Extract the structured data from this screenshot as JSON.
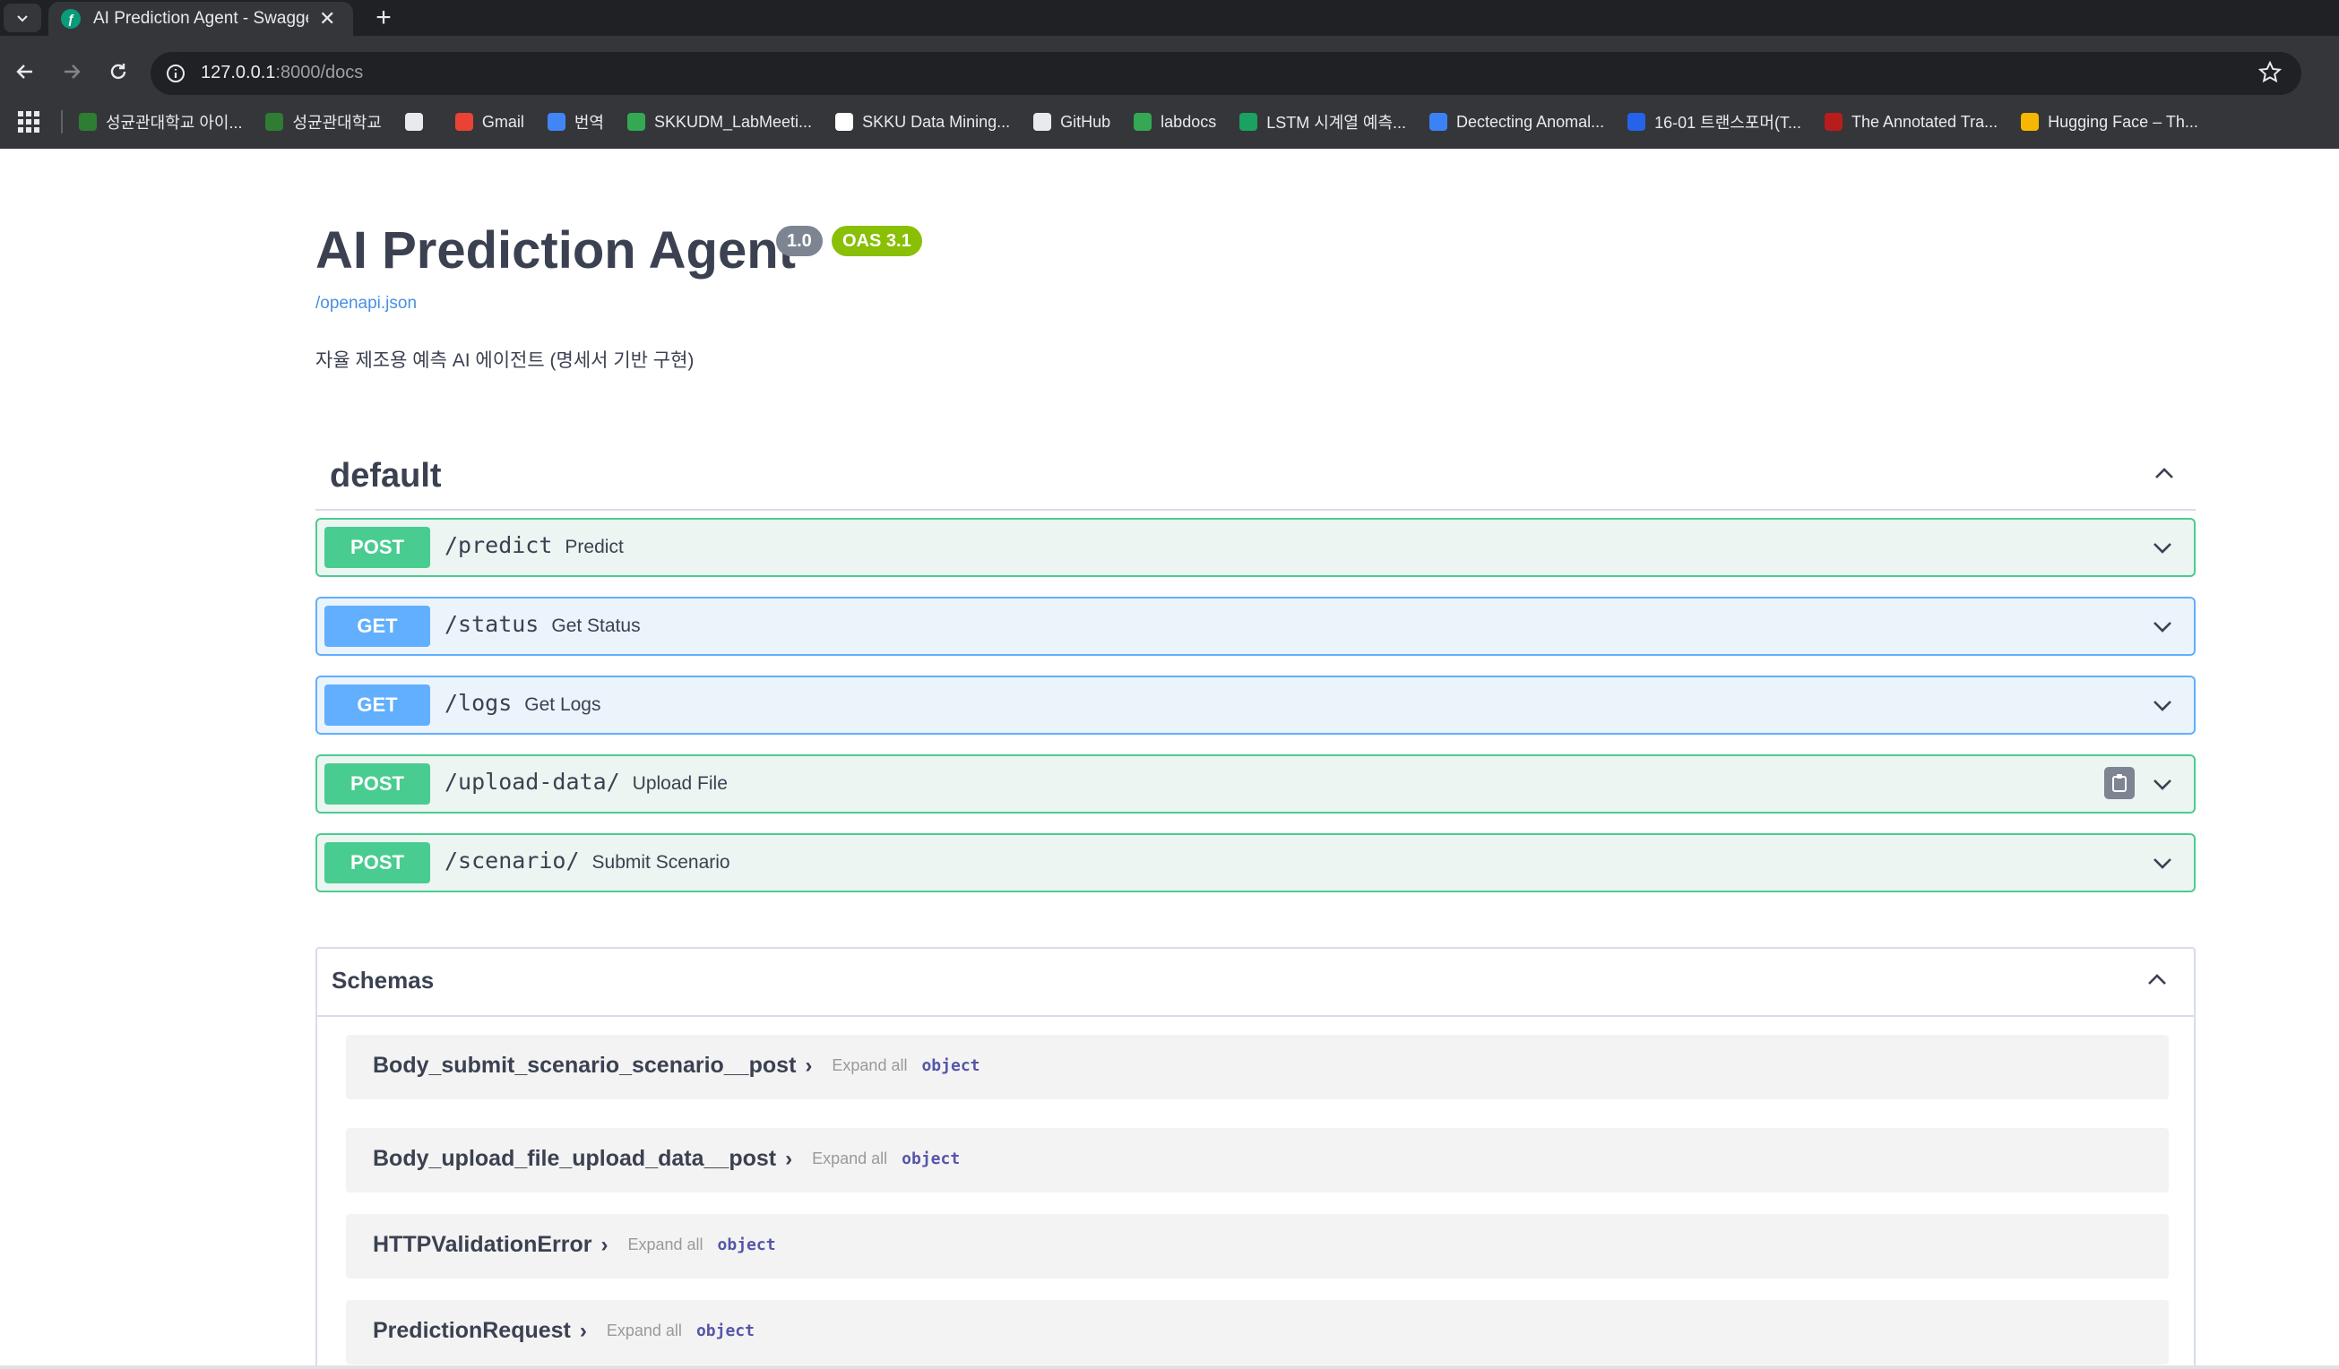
{
  "browser": {
    "tab_title": "AI Prediction Agent - Swagger UI",
    "url_host": "127.0.0.1",
    "url_rest": ":8000/docs",
    "bookmarks": [
      {
        "label": "성균관대학교 아이...",
        "color": "#2e7d32"
      },
      {
        "label": "성균관대학교",
        "color": "#2e7d32"
      },
      {
        "label": "",
        "color": "#e8eaed"
      },
      {
        "label": "Gmail",
        "color": "#ea4335"
      },
      {
        "label": "번역",
        "color": "#4285f4"
      },
      {
        "label": "SKKUDM_LabMeeti...",
        "color": "#34a853"
      },
      {
        "label": "SKKU Data Mining...",
        "color": "#ffffff"
      },
      {
        "label": "GitHub",
        "color": "#e8eaed"
      },
      {
        "label": "labdocs",
        "color": "#34a853"
      },
      {
        "label": "LSTM 시계열 예측...",
        "color": "#1aa260"
      },
      {
        "label": "Dectecting Anomal...",
        "color": "#3b82f6"
      },
      {
        "label": "16-01 트랜스포머(T...",
        "color": "#2563eb"
      },
      {
        "label": "The Annotated Tra...",
        "color": "#b91c1c"
      },
      {
        "label": "Hugging Face – Th...",
        "color": "#f5b700"
      }
    ]
  },
  "api": {
    "title": "AI Prediction Agent",
    "version": "1.0",
    "oas": "OAS 3.1",
    "spec_link": "/openapi.json",
    "description": "자율 제조용 예측 AI 에이전트 (명세서 기반 구현)"
  },
  "section": {
    "title": "default",
    "operations": [
      {
        "method": "POST",
        "path": "/predict",
        "summary": "Predict"
      },
      {
        "method": "GET",
        "path": "/status",
        "summary": "Get Status"
      },
      {
        "method": "GET",
        "path": "/logs",
        "summary": "Get Logs"
      },
      {
        "method": "POST",
        "path": "/upload-data/",
        "summary": "Upload File"
      },
      {
        "method": "POST",
        "path": "/scenario/",
        "summary": "Submit Scenario"
      }
    ]
  },
  "schemas": {
    "title": "Schemas",
    "expand_label": "Expand all",
    "type_label": "object",
    "models": [
      {
        "name": "Body_submit_scenario_scenario__post"
      },
      {
        "name": "Body_upload_file_upload_data__post"
      },
      {
        "name": "HTTPValidationError"
      },
      {
        "name": "PredictionRequest"
      }
    ]
  },
  "colors": {
    "post": "#49cc90",
    "get": "#61affe",
    "oas": "#89bf04",
    "version": "#7d8492"
  }
}
